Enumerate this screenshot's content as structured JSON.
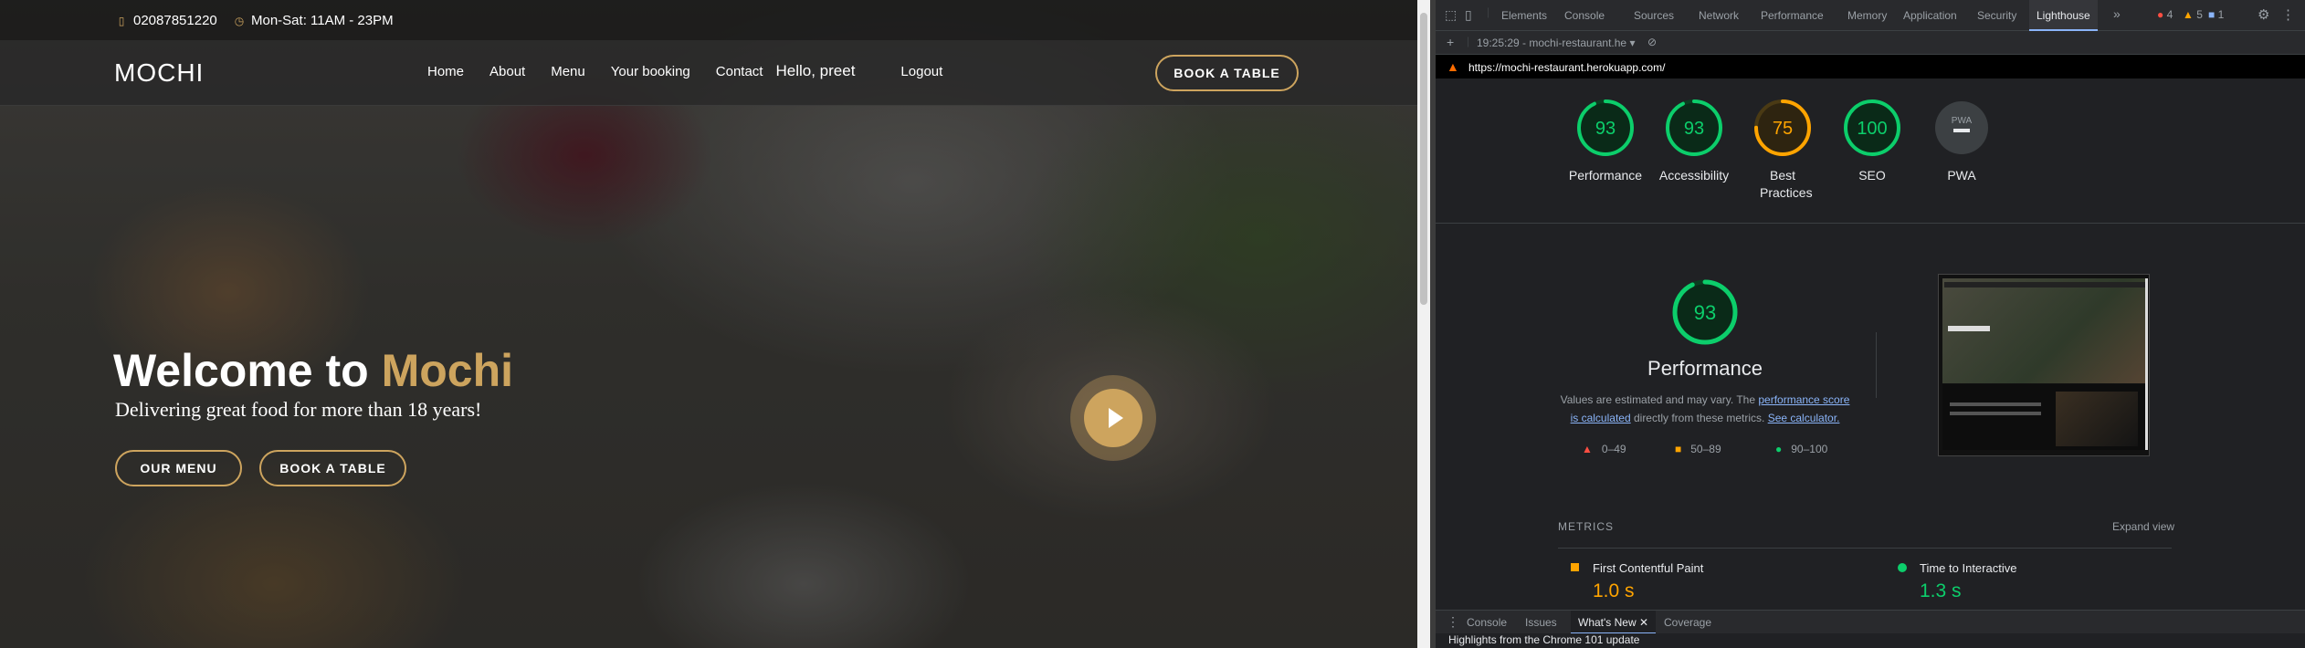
{
  "site": {
    "topbar": {
      "phone": "02087851220",
      "hours": "Mon-Sat: 11AM - 23PM"
    },
    "logo": "MOCHI",
    "nav": [
      "Home",
      "About",
      "Menu",
      "Your booking",
      "Contact"
    ],
    "greeting": "Hello, preet",
    "logout": "Logout",
    "book_top": "BOOK A TABLE",
    "hero": {
      "title_a": "Welcome to ",
      "title_b": "Mochi",
      "subtitle": "Delivering great food for more than 18 years!"
    },
    "btn_menu": "OUR MENU",
    "btn_book": "BOOK A TABLE",
    "accent": "#cda45e"
  },
  "devtools": {
    "tabs": [
      "Elements",
      "Console",
      "Sources",
      "Network",
      "Performance",
      "Memory",
      "Application",
      "Security",
      "Lighthouse"
    ],
    "more": "»",
    "badges": {
      "errors": "4",
      "warnings": "5",
      "messages": "1"
    },
    "report_select": "19:25:29 - mochi-restaurant.he",
    "url": "https://mochi-restaurant.herokuapp.com/",
    "scores": [
      {
        "label": "Performance",
        "value": 93,
        "color": "#0cce6b"
      },
      {
        "label": "Accessibility",
        "value": 93,
        "color": "#0cce6b"
      },
      {
        "label": "Best Practices",
        "value": 75,
        "color": "#ffa400"
      },
      {
        "label": "SEO",
        "value": 100,
        "color": "#0cce6b"
      },
      {
        "label": "PWA",
        "value": "PWA",
        "color": "#9aa0a6"
      }
    ],
    "perf": {
      "score": "93",
      "title": "Performance",
      "desc_a": "Values are estimated and may vary. The ",
      "desc_link1": "performance score is calculated",
      "desc_b": " directly from these metrics. ",
      "desc_link2": "See calculator."
    },
    "legend": [
      {
        "range": "0–49",
        "color": "#ff4e42",
        "shape": "triangle"
      },
      {
        "range": "50–89",
        "color": "#ffa400",
        "shape": "square"
      },
      {
        "range": "90–100",
        "color": "#0cce6b",
        "shape": "circle"
      }
    ],
    "metrics_header": "METRICS",
    "expand": "Expand view",
    "metrics": [
      {
        "name": "First Contentful Paint",
        "value": "1.0 s",
        "color": "#ffa400"
      },
      {
        "name": "Time to Interactive",
        "value": "1.3 s",
        "color": "#0cce6b"
      }
    ],
    "drawer_tabs": [
      "Console",
      "Issues",
      "What's New",
      "Coverage"
    ],
    "footer_text": "Highlights from the Chrome 101 update"
  }
}
